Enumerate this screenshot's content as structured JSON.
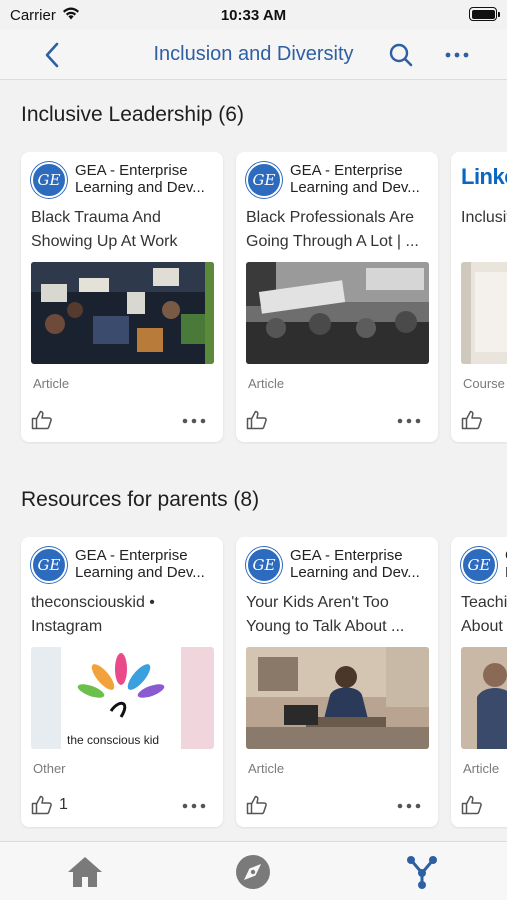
{
  "status_bar": {
    "carrier": "Carrier",
    "time": "10:33 AM",
    "battery": 1.0
  },
  "nav": {
    "title": "Inclusion and Diversity"
  },
  "sections": [
    {
      "title": "Inclusive Leadership (6)",
      "cards": [
        {
          "source_line1": "GEA - Enterprise",
          "source_line2": "Learning and Dev...",
          "title_line1": "Black Trauma And",
          "title_line2": "Showing Up At Work",
          "type": "Article",
          "likes": ""
        },
        {
          "source_line1": "GEA - Enterprise",
          "source_line2": "Learning and Dev...",
          "title_line1": "Black Professionals Are",
          "title_line2": "Going Through A Lot | ...",
          "type": "Article",
          "likes": ""
        },
        {
          "source_line1": "Linke",
          "source_line2": "",
          "title_line1": "Inclusiv",
          "title_line2": "",
          "type": "Course",
          "likes": ""
        }
      ]
    },
    {
      "title": "Resources for parents (8)",
      "cards": [
        {
          "source_line1": "GEA - Enterprise",
          "source_line2": "Learning and Dev...",
          "title_line1": "theconsciouskid •",
          "title_line2": "Instagram",
          "type": "Other",
          "likes": "1",
          "thumb_caption": "the conscious kid"
        },
        {
          "source_line1": "GEA - Enterprise",
          "source_line2": "Learning and Dev...",
          "title_line1": "Your Kids Aren't Too",
          "title_line2": "Young to Talk About ...",
          "type": "Article",
          "likes": ""
        },
        {
          "source_line1": "G",
          "source_line2": "L",
          "title_line1": "Teachi",
          "title_line2": "About",
          "type": "Article",
          "likes": ""
        }
      ]
    }
  ],
  "icons": {
    "logo_letters": "GE",
    "accent_color": "#2e5fa3",
    "tabs": [
      "home-icon",
      "compass-icon",
      "network-icon"
    ]
  }
}
